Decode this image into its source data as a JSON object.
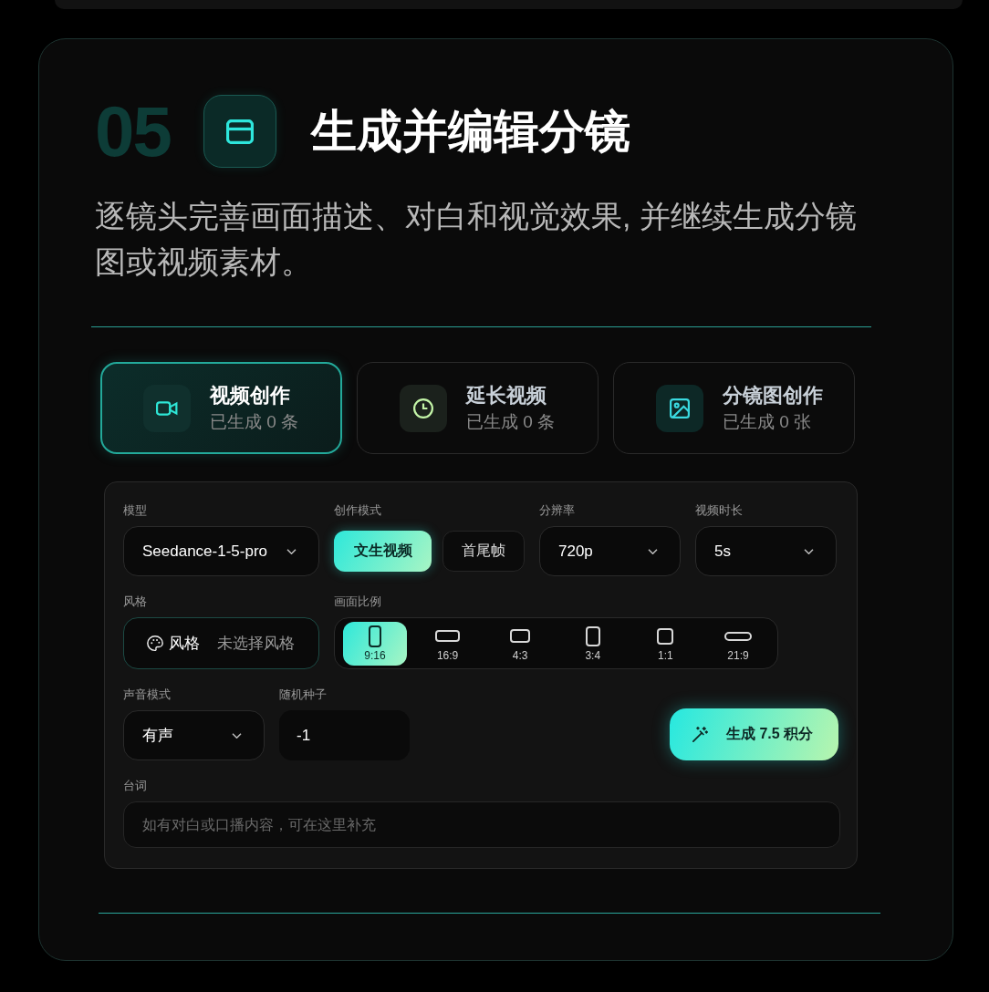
{
  "section": {
    "number": "05",
    "title": "生成并编辑分镜",
    "description": "逐镜头完善画面描述、对白和视觉效果, 并继续生成分镜图或视频素材。"
  },
  "tabs": [
    {
      "kind": "video",
      "title": "视频创作",
      "subtitle": "已生成 0 条",
      "selected": true
    },
    {
      "kind": "extend",
      "title": "延长视频",
      "subtitle": "已生成 0 条",
      "selected": false
    },
    {
      "kind": "storyboard",
      "title": "分镜图创作",
      "subtitle": "已生成 0 张",
      "selected": false
    }
  ],
  "form": {
    "model": {
      "label": "模型",
      "value": "Seedance-1-5-pro"
    },
    "mode": {
      "label": "创作模式",
      "options": [
        {
          "label": "文生视频",
          "selected": true
        },
        {
          "label": "首尾帧",
          "selected": false
        }
      ]
    },
    "resolution": {
      "label": "分辨率",
      "value": "720p"
    },
    "duration": {
      "label": "视频时长",
      "value": "5s"
    },
    "style": {
      "label": "风格",
      "button_label": "风格",
      "value": "未选择风格"
    },
    "aspect_ratio": {
      "label": "画面比例",
      "options": [
        {
          "kind": "tall",
          "label": "9:16",
          "selected": true
        },
        {
          "kind": "wide",
          "label": "16:9",
          "selected": false
        },
        {
          "kind": "landscape",
          "label": "4:3",
          "selected": false
        },
        {
          "kind": "portrait",
          "label": "3:4",
          "selected": false
        },
        {
          "kind": "square",
          "label": "1:1",
          "selected": false
        },
        {
          "kind": "ultrawide",
          "label": "21:9",
          "selected": false
        }
      ]
    },
    "audio": {
      "label": "声音模式",
      "value": "有声"
    },
    "seed": {
      "label": "随机种子",
      "value": "-1"
    },
    "generate_button": {
      "label": "生成 7.5 积分"
    },
    "dialogue": {
      "label": "台词",
      "placeholder": "如有对白或口播内容，可在这里补充"
    }
  }
}
